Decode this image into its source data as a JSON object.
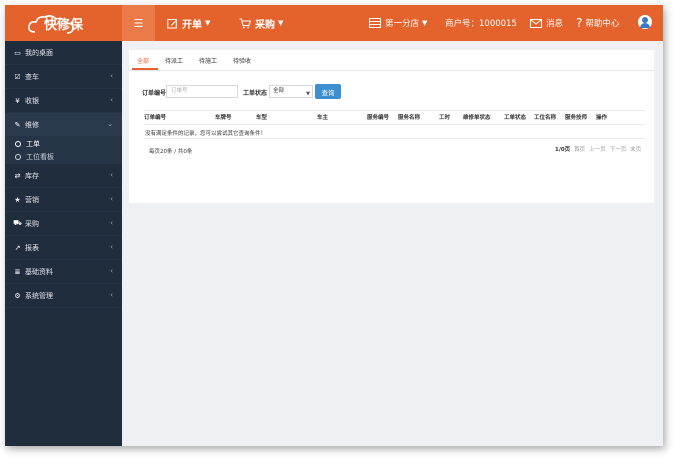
{
  "app": {
    "logo_text": "快修保"
  },
  "top_menu": {
    "toggle_icon": "list-icon",
    "items": [
      {
        "label": "开单",
        "icon": "edit-icon"
      },
      {
        "label": "采购",
        "icon": "cart-icon"
      }
    ]
  },
  "top_right": {
    "store": "第一分店",
    "merchant": "商户号：1000015",
    "messages": "消息",
    "help": "帮助中心"
  },
  "sidebar": {
    "items": [
      {
        "label": "我的桌面",
        "icon": "desktop-icon"
      },
      {
        "label": "查车",
        "icon": "check-icon"
      },
      {
        "label": "收银",
        "icon": "yen-icon"
      },
      {
        "label": "维修",
        "icon": "wrench-icon"
      },
      {
        "label": "库存",
        "icon": "shuffle-icon"
      },
      {
        "label": "营销",
        "icon": "star-icon"
      },
      {
        "label": "采购",
        "icon": "cart-icon"
      },
      {
        "label": "报表",
        "icon": "chart-icon"
      },
      {
        "label": "基础资料",
        "icon": "database-icon"
      },
      {
        "label": "系统管理",
        "icon": "gear-icon"
      }
    ],
    "sub_items": [
      "工单",
      "工位看板"
    ]
  },
  "tabs": [
    "全部",
    "待派工",
    "待施工",
    "待验收"
  ],
  "filter": {
    "order_label": "订单编号",
    "order_placeholder": "订单号",
    "status_label": "工单状态",
    "status_value": "全部",
    "query_button": "查询"
  },
  "table": {
    "headers": [
      "订单编号",
      "车牌号",
      "车型",
      "车主",
      "服务编号",
      "服务名称",
      "工时",
      "维修单状态",
      "工单状态",
      "工位名称",
      "服务技师",
      "操作"
    ],
    "empty_message": "没有满足条件的记录，您可以尝试其它查询条件！"
  },
  "footer": {
    "summary": "每页20条 / 共0条",
    "page_info": "1/0页",
    "first": "首页",
    "prev": "上一页",
    "next": "下一页",
    "last": "末页"
  },
  "colors": {
    "brand": "#e4622b",
    "sidebar": "#1f2d3d",
    "button": "#3b8fd1"
  }
}
